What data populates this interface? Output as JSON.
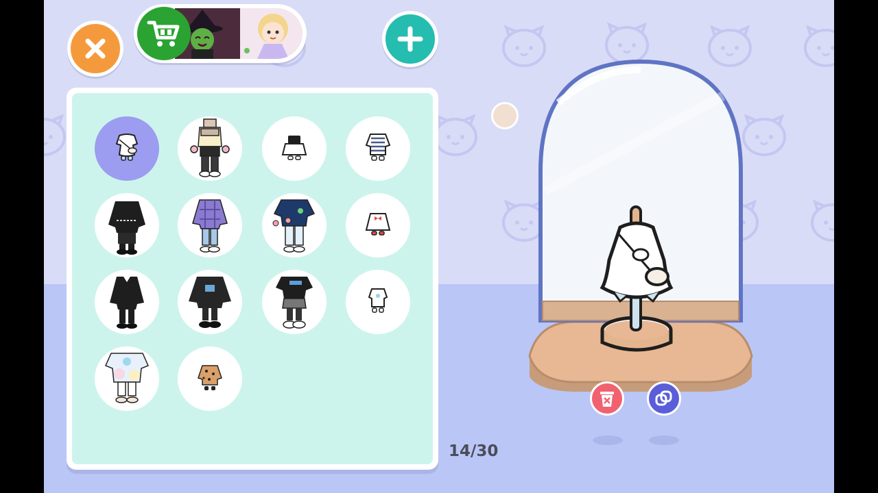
{
  "counter": {
    "text": "14/30"
  },
  "toolbar": {
    "close_icon": "close-icon",
    "cart_icon": "shopping-cart-icon",
    "add_icon": "plus-icon"
  },
  "wardrobe": {
    "selected_index": 0,
    "outfits": [
      {
        "name": "white-dress-with-bag"
      },
      {
        "name": "beige-scarf-striped-top"
      },
      {
        "name": "black-top-white-skirt"
      },
      {
        "name": "striped-sailor-top"
      },
      {
        "name": "black-gothic-jacket"
      },
      {
        "name": "purple-plaid-jacket"
      },
      {
        "name": "navy-tee-with-flower"
      },
      {
        "name": "white-ruffle-dress-red-bow"
      },
      {
        "name": "black-school-uniform"
      },
      {
        "name": "black-hoodie-outfit"
      },
      {
        "name": "black-logo-tee-skirt"
      },
      {
        "name": "white-baby-romper"
      },
      {
        "name": "pastel-tie-dye-tee"
      },
      {
        "name": "leopard-print-outfit"
      }
    ]
  },
  "showcase": {
    "delete_icon": "trash-icon",
    "copy_icon": "duplicate-icon"
  },
  "colors": {
    "close": "#f59a3c",
    "add": "#25bdb0",
    "cart": "#2aa332",
    "selected_slot": "#9c9cf0",
    "panel": "#cdf4ec",
    "delete": "#f16270",
    "copy": "#5a5ed9"
  }
}
